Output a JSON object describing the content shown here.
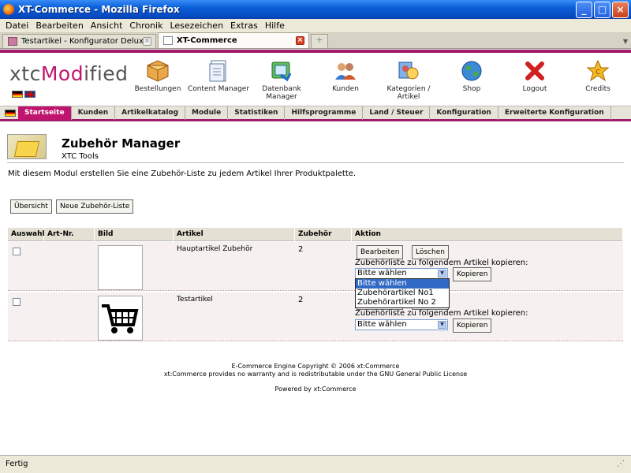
{
  "window": {
    "title": "XT-Commerce - Mozilla Firefox"
  },
  "menu": [
    "Datei",
    "Bearbeiten",
    "Ansicht",
    "Chronik",
    "Lesezeichen",
    "Extras",
    "Hilfe"
  ],
  "tabs": [
    {
      "label": "Testartikel - Konfigurator Deluxe",
      "active": false
    },
    {
      "label": "XT-Commerce",
      "active": true
    }
  ],
  "logo": {
    "part1": "xtc",
    "part2": "Mod",
    "part3": "ified"
  },
  "topnav": [
    {
      "label": "Bestellungen",
      "icon": "box-icon"
    },
    {
      "label": "Content Manager",
      "icon": "document-icon"
    },
    {
      "label": "Datenbank Manager",
      "icon": "database-icon"
    },
    {
      "label": "Kunden",
      "icon": "users-icon"
    },
    {
      "label": "Kategorien / Artikel",
      "icon": "category-icon"
    },
    {
      "label": "Shop",
      "icon": "globe-icon"
    },
    {
      "label": "Logout",
      "icon": "x-icon"
    },
    {
      "label": "Credits",
      "icon": "star-icon"
    }
  ],
  "mainnav": [
    "Startseite",
    "Kunden",
    "Artikelkatalog",
    "Module",
    "Statistiken",
    "Hilfsprogramme",
    "Land / Steuer",
    "Konfiguration",
    "Erweiterte Konfiguration"
  ],
  "page": {
    "title": "Zubehör Manager",
    "subtitle": "XTC Tools",
    "intro": "Mit diesem Modul erstellen Sie eine Zubehör-Liste zu jedem Artikel Ihrer Produktpalette."
  },
  "buttons": {
    "overview": "Übersicht",
    "new_list": "Neue Zubehör-Liste",
    "edit": "Bearbeiten",
    "delete": "Löschen",
    "copy": "Kopieren"
  },
  "table": {
    "headers": [
      "Auswahl",
      "Art-Nr.",
      "Bild",
      "Artikel",
      "Zubehör",
      "Aktion"
    ],
    "copy_label": "Zubehörliste zu folgendem Artikel kopieren:",
    "rows": [
      {
        "article": "Hauptartikel Zubehör",
        "count": "2",
        "select": "Bitte wählen"
      },
      {
        "article": "Testartikel",
        "count": "2",
        "select": "Bitte wählen"
      }
    ]
  },
  "dropdown": {
    "options": [
      "Bitte wählen",
      "Zubehörartikel No1",
      "Zubehörartikel No 2"
    ]
  },
  "footer": {
    "line1": "E-Commerce Engine Copyright © 2006 xt:Commerce",
    "line2": "xt:Commerce provides no warranty and is redistributable under the GNU General Public License",
    "line3": "Powered by xt:Commerce"
  },
  "status": {
    "text": "Fertig"
  }
}
